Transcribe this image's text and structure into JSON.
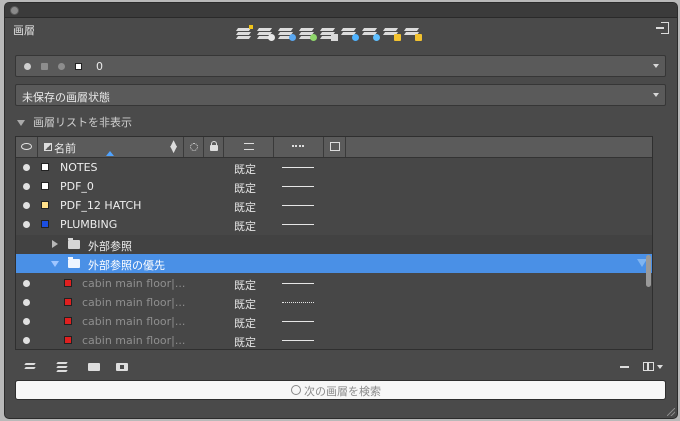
{
  "panel": {
    "title": "画層"
  },
  "current_layer": {
    "name": "0"
  },
  "layer_state": {
    "value": "未保存の画層状態"
  },
  "list_toggle": {
    "label": "画層リストを非表示"
  },
  "columns": {
    "name": "名前"
  },
  "rows": [
    {
      "name": "NOTES",
      "linetype": "既定",
      "color": "#ffffff",
      "line": "solid"
    },
    {
      "name": "PDF_0",
      "linetype": "既定",
      "color": "#ffffff",
      "line": "solid"
    },
    {
      "name": "PDF_12 HATCH",
      "linetype": "既定",
      "color": "#ffe08a",
      "line": "solid"
    },
    {
      "name": "PLUMBING",
      "linetype": "既定",
      "color": "#1c4fe0",
      "line": "solid"
    }
  ],
  "groups": [
    {
      "label": "外部参照"
    },
    {
      "label": "外部参照の優先"
    }
  ],
  "xref_rows": [
    {
      "name": "cabin main floor|...",
      "linetype": "既定",
      "color": "#e02020",
      "line": "solid"
    },
    {
      "name": "cabin main floor|...",
      "linetype": "既定",
      "color": "#e02020",
      "line": "dotted"
    },
    {
      "name": "cabin main floor|...",
      "linetype": "既定",
      "color": "#e02020",
      "line": "solid"
    },
    {
      "name": "cabin main floor|...",
      "linetype": "既定",
      "color": "#e02020",
      "line": "solid"
    }
  ],
  "search": {
    "placeholder": "次の画層を検索"
  },
  "colors": {
    "accent": "#4a90e6",
    "panel_bg": "#4a4a4a"
  }
}
